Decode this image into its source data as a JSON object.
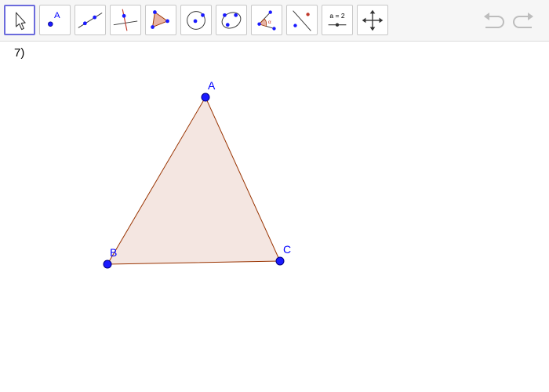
{
  "toolbar": {
    "tools": [
      {
        "icon": "move-arrow-icon",
        "selected": true
      },
      {
        "icon": "point-icon",
        "selected": false,
        "text": "A"
      },
      {
        "icon": "line-icon",
        "selected": false
      },
      {
        "icon": "perpendicular-line-icon",
        "selected": false
      },
      {
        "icon": "polygon-icon",
        "selected": false
      },
      {
        "icon": "circle-icon",
        "selected": false
      },
      {
        "icon": "conic-icon",
        "selected": false
      },
      {
        "icon": "angle-icon",
        "selected": false
      },
      {
        "icon": "reflect-icon",
        "selected": false
      },
      {
        "icon": "slider-icon",
        "selected": false,
        "text": "a = 2"
      },
      {
        "icon": "move-graphics-view-icon",
        "selected": false
      }
    ],
    "undo_icon": "undo-icon",
    "redo_icon": "redo-icon"
  },
  "exercise": {
    "label": "7)"
  },
  "figure": {
    "points": [
      {
        "name": "A"
      },
      {
        "name": "B"
      },
      {
        "name": "C"
      }
    ]
  },
  "colors": {
    "accent": "#6b6bdc",
    "point_fill": "#1a1aff",
    "point_stroke": "#000080",
    "label": "#0000ff",
    "polygon_fill": "#f4e6e1",
    "polygon_edge": "#993300",
    "icon_dark": "#333333",
    "icon_red": "#c0392b"
  }
}
